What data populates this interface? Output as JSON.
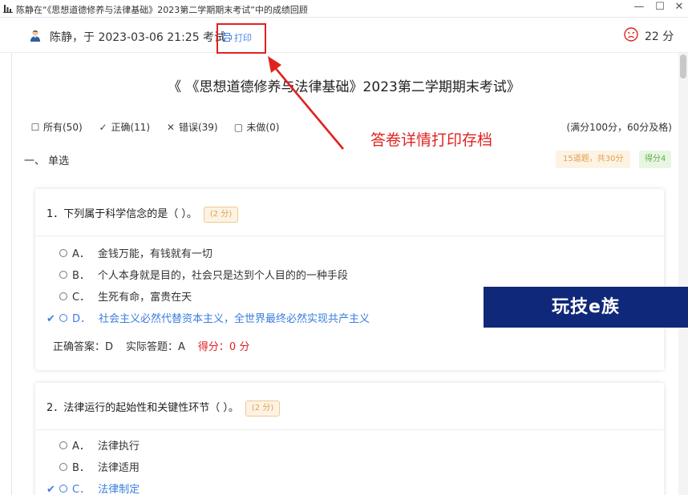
{
  "window": {
    "title": "陈静在“《思想道德修养与法律基础》2023第二学期期末考试”中的成绩回顾",
    "minimize": "—",
    "maximize": "☐",
    "close": "✕"
  },
  "header": {
    "info": "陈静，于 2023-03-06 21:25 考试",
    "print_label": "打印",
    "score": "22 分"
  },
  "exam_title": "《 《思想道德修养与法律基础》2023第二学期期末考试》",
  "filters": [
    {
      "icon": "☐",
      "label": "所有(50)"
    },
    {
      "icon": "✓",
      "label": "正确(11)"
    },
    {
      "icon": "✕",
      "label": "错误(39)"
    },
    {
      "icon": "▢",
      "label": "未做(0)"
    }
  ],
  "full_score_text": "(满分100分，60分及格)",
  "annotation": "答卷详情打印存档",
  "section": {
    "title": "一、 单选",
    "count_badge": "15道题，共30分",
    "score_badge": "得分4"
  },
  "questions": [
    {
      "number_text": "1．下列属于科学信念的是（ ）。",
      "points": "(2 分)",
      "options": [
        {
          "letter": "A．",
          "text": "金钱万能，有钱就有一切"
        },
        {
          "letter": "B．",
          "text": "个人本身就是目的，社会只是达到个人目的的一种手段"
        },
        {
          "letter": "C．",
          "text": "生死有命，富贵在天"
        },
        {
          "letter": "D．",
          "text": "社会主义必然代替资本主义，全世界最终必然实现共产主义"
        }
      ],
      "correct_answer": "正确答案：D",
      "actual_answer": "实际答题：A",
      "score": "得分：0 分"
    },
    {
      "number_text": "2．法律运行的起始性和关键性环节（ ）。",
      "points": "(2 分)",
      "options": [
        {
          "letter": "A．",
          "text": "法律执行"
        },
        {
          "letter": "B．",
          "text": "法律适用"
        },
        {
          "letter": "C．",
          "text": "法律制定"
        }
      ]
    }
  ],
  "watermark": "玩技e族",
  "colors": {
    "accent_blue": "#3b7ddd",
    "red": "#e0221f",
    "orange_badge": "#e3a04b",
    "green_badge": "#5db043",
    "watermark_bg": "#10287a"
  }
}
